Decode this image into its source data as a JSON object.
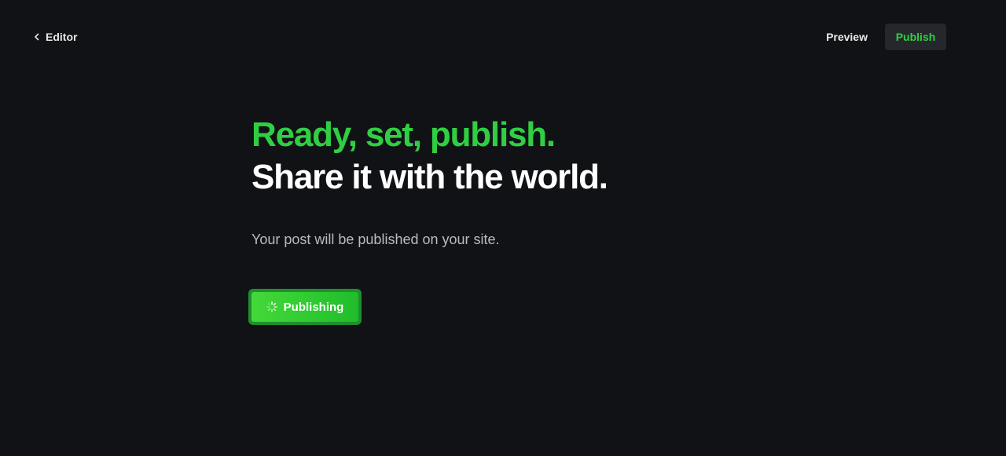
{
  "topbar": {
    "back_label": "Editor",
    "preview_label": "Preview",
    "publish_label": "Publish"
  },
  "main": {
    "headline_line1": "Ready, set, publish.",
    "headline_line2": "Share it with the world.",
    "subtext": "Your post will be published on your site.",
    "publishing_label": "Publishing"
  },
  "colors": {
    "background": "#111216",
    "accent_green": "#30cf43",
    "publish_button_bg": "#25272c"
  },
  "icons": {
    "back": "chevron-left-icon",
    "spinner": "spinner-icon"
  }
}
